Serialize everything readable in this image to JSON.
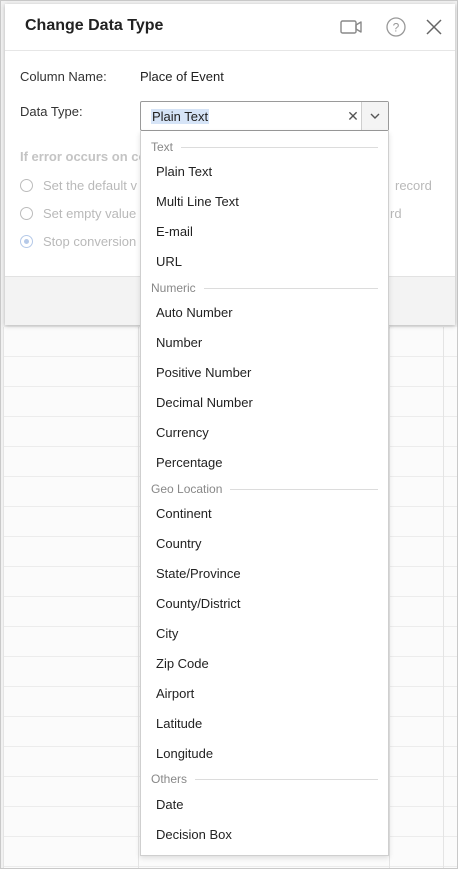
{
  "dialog": {
    "title": "Change Data Type",
    "icons": {
      "video": "video-camera-icon",
      "help": "question-mark-icon",
      "close": "close-icon"
    }
  },
  "form": {
    "column_name_label": "Column Name:",
    "column_name_value": "Place of Event",
    "data_type_label": "Data Type:",
    "data_type_value": "Plain Text",
    "error_heading": "If error occurs on con",
    "error_options": [
      {
        "left_text": "Set the default v",
        "right_text": "record",
        "selected": false
      },
      {
        "left_text": "Set empty value",
        "right_text": "rd",
        "selected": false
      },
      {
        "left_text": "Stop conversion",
        "right_text": "",
        "selected": true
      }
    ]
  },
  "dropdown": {
    "groups": [
      {
        "label": "Text",
        "options": [
          "Plain Text",
          "Multi Line Text",
          "E-mail",
          "URL"
        ]
      },
      {
        "label": "Numeric",
        "options": [
          "Auto Number",
          "Number",
          "Positive Number",
          "Decimal Number",
          "Currency",
          "Percentage"
        ]
      },
      {
        "label": "Geo Location",
        "options": [
          "Continent",
          "Country",
          "State/Province",
          "County/District",
          "City",
          "Zip Code",
          "Airport",
          "Latitude",
          "Longitude"
        ]
      },
      {
        "label": "Others",
        "options": [
          "Date",
          "Decision Box"
        ]
      }
    ]
  },
  "colors": {
    "selection_highlight": "#d6e4f7",
    "disabled_text": "#b9b9b9"
  }
}
